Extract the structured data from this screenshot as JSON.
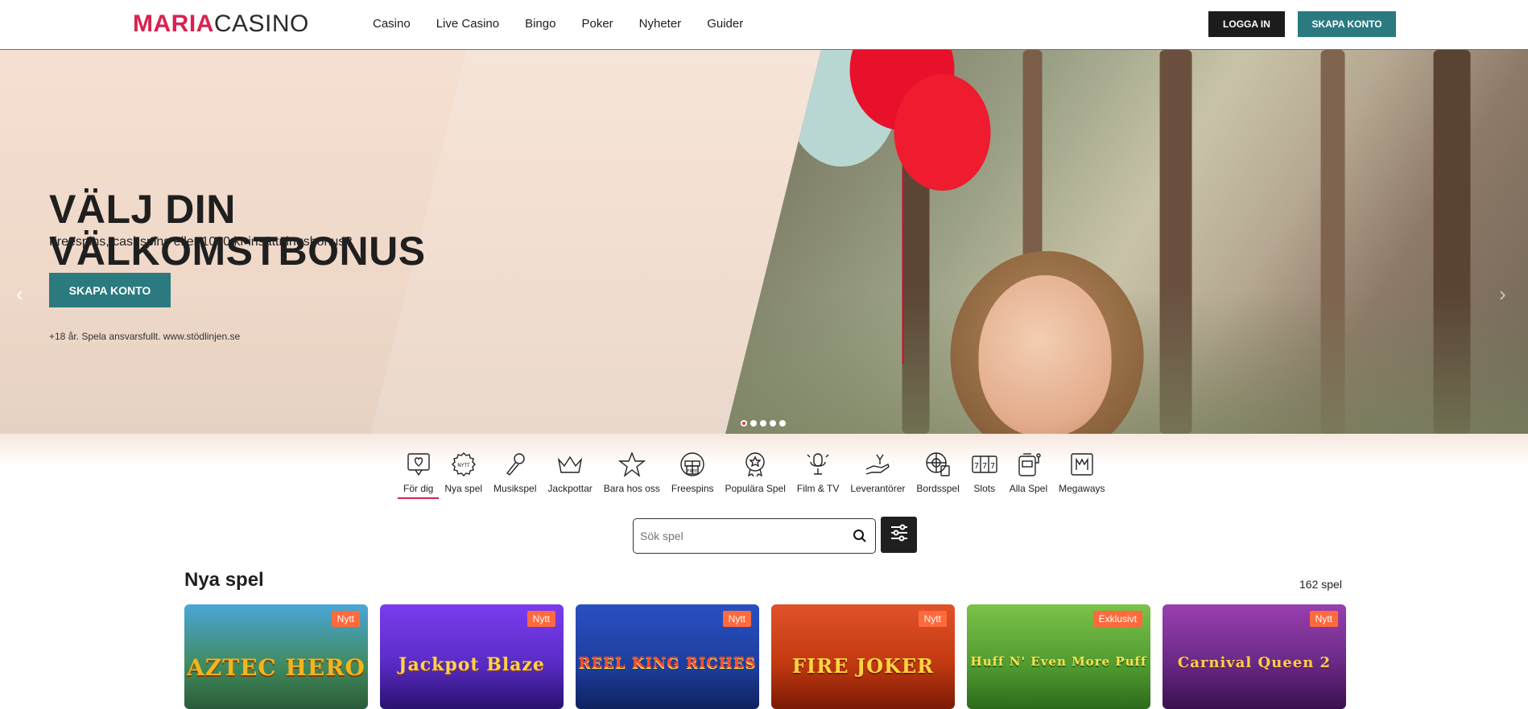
{
  "header": {
    "logo_part1": "MARIA",
    "logo_part2": "CASINO",
    "nav": [
      "Casino",
      "Live Casino",
      "Bingo",
      "Poker",
      "Nyheter",
      "Guider"
    ],
    "login_label": "LOGGA IN",
    "signup_label": "SKAPA KONTO"
  },
  "hero": {
    "title_line1": "VÄLJ DIN",
    "title_line2": "VÄLKOMSTBONUS",
    "subtitle": "Freespins, cashspins eller 1000 kr insättningsbonus?",
    "cta_label": "SKAPA KONTO",
    "legal": "+18 år. Spela ansvarsfullt. www.stödlinjen.se",
    "slide_count": 5,
    "active_slide": 1
  },
  "categories": [
    {
      "label": "För dig",
      "icon": "heart-speech-icon",
      "active": true
    },
    {
      "label": "Nya spel",
      "icon": "new-badge-icon",
      "active": false
    },
    {
      "label": "Musikspel",
      "icon": "microphone-icon",
      "active": false
    },
    {
      "label": "Jackpottar",
      "icon": "crown-icon",
      "active": false
    },
    {
      "label": "Bara hos oss",
      "icon": "star-icon",
      "active": false
    },
    {
      "label": "Freespins",
      "icon": "free-gift-icon",
      "active": false
    },
    {
      "label": "Populära Spel",
      "icon": "medal-icon",
      "active": false
    },
    {
      "label": "Film & TV",
      "icon": "film-mic-icon",
      "active": false
    },
    {
      "label": "Leverantörer",
      "icon": "hand-icon",
      "active": false
    },
    {
      "label": "Bordsspel",
      "icon": "roulette-icon",
      "active": false
    },
    {
      "label": "Slots",
      "icon": "slots-777-icon",
      "active": false
    },
    {
      "label": "Alla Spel",
      "icon": "slot-machine-icon",
      "active": false
    },
    {
      "label": "Megaways",
      "icon": "megaways-icon",
      "active": false
    }
  ],
  "search": {
    "placeholder": "Sök spel"
  },
  "section": {
    "title": "Nya spel",
    "count": "162 spel"
  },
  "games": [
    {
      "title": "AZTEC HERO",
      "badge": "Nytt",
      "bg": "#3f8a5c",
      "fg": "#f5b41c"
    },
    {
      "title": "Jackpot Blaze",
      "badge": "Nytt",
      "bg": "#5b2cc7",
      "fg": "#ffd34d"
    },
    {
      "title": "REEL KING RICHES",
      "badge": "Nytt",
      "bg": "#1e3d9c",
      "fg": "#ff4b2b"
    },
    {
      "title": "FIRE JOKER",
      "badge": "Nytt",
      "bg": "#c43a10",
      "fg": "#ffd640"
    },
    {
      "title": "Huff N' Even More Puff",
      "badge": "Exklusivt",
      "bg": "#4f9a2f",
      "fg": "#ffe14d"
    },
    {
      "title": "Carnival Queen 2",
      "badge": "Nytt",
      "bg": "#6a2a86",
      "fg": "#ffcf4a"
    }
  ],
  "colors": {
    "brand": "#d9214f",
    "teal": "#2a7a80",
    "dark": "#1c1c1c",
    "badge": "#ff6a3d"
  }
}
